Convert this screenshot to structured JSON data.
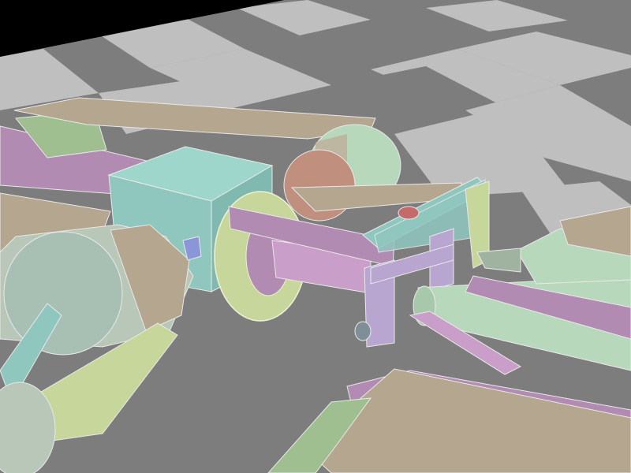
{
  "scene": {
    "background": "#000000",
    "floor_light": "#bfbfbf",
    "floor_dark": "#7d7d7d",
    "wire": "#e9e9e9",
    "palette": {
      "teal": "#8fc7bf",
      "tan": "#b5a690",
      "pink": "#b18bb1",
      "green": "#9fbf90",
      "lime": "#c7d69a",
      "lavender": "#b8a6d0",
      "mint": "#b8d8bc",
      "salmon": "#c08f7e",
      "coral": "#c46a6a",
      "steel": "#9fb0b8",
      "sage": "#9fb3a0",
      "slate": "#7f8f9a",
      "blue": "#8b96d8",
      "darktan": "#a89a86"
    }
  }
}
